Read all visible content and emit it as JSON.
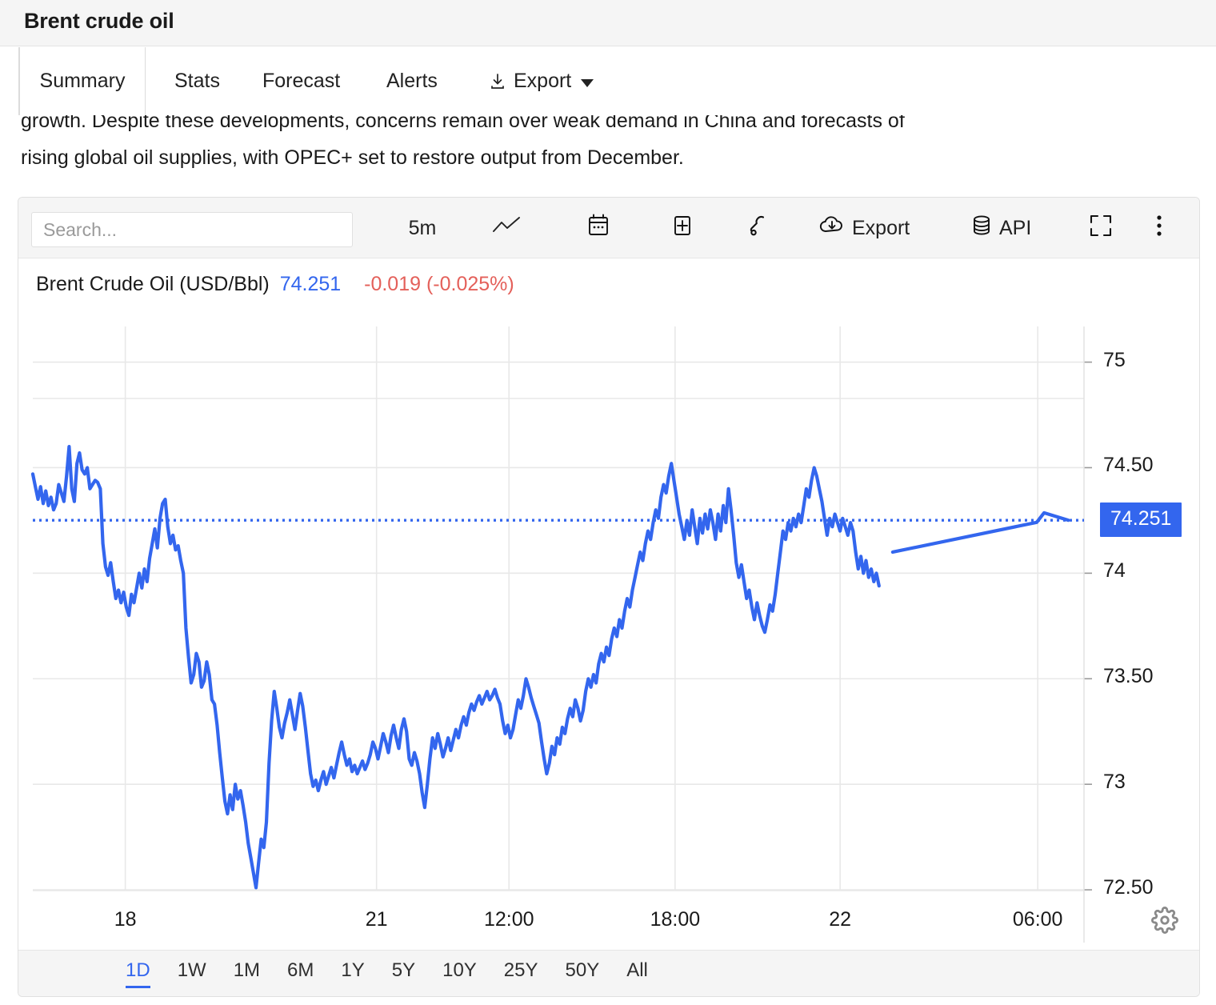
{
  "header": {
    "title": "Brent crude oil"
  },
  "tabs": [
    {
      "label": "Summary",
      "active": true
    },
    {
      "label": "Stats",
      "active": false
    },
    {
      "label": "Forecast",
      "active": false
    },
    {
      "label": "Alerts",
      "active": false
    },
    {
      "label": "Export",
      "active": false,
      "icon": "download-icon",
      "caret": true
    }
  ],
  "intro": {
    "line1": "growth. Despite these developments, concerns remain over weak demand in China and forecasts of",
    "line2": "rising global oil supplies, with OPEC+ set to restore output from December."
  },
  "toolbar": {
    "search_placeholder": "Search...",
    "interval": "5m",
    "chart_type_icon": "line-chart-icon",
    "calendar_icon": "calendar-icon",
    "add_icon": "plus-box-icon",
    "tools_icon": "wrench-icon",
    "export_label": "Export",
    "export_icon": "cloud-download-icon",
    "api_label": "API",
    "api_icon": "database-icon",
    "fullscreen_icon": "fullscreen-icon",
    "more_icon": "kebab-menu-icon"
  },
  "quote": {
    "name": "Brent Crude Oil (USD/Bbl)",
    "price": "74.251",
    "change": "-0.019 (-0.025%)"
  },
  "settings": {
    "gear_icon": "gear-icon"
  },
  "ranges": [
    {
      "label": "1D",
      "active": true
    },
    {
      "label": "1W",
      "active": false
    },
    {
      "label": "1M",
      "active": false
    },
    {
      "label": "6M",
      "active": false
    },
    {
      "label": "1Y",
      "active": false
    },
    {
      "label": "5Y",
      "active": false
    },
    {
      "label": "10Y",
      "active": false
    },
    {
      "label": "25Y",
      "active": false
    },
    {
      "label": "50Y",
      "active": false
    },
    {
      "label": "All",
      "active": false
    }
  ],
  "colors": {
    "line": "#3366ee",
    "reference_line": "#3366ee",
    "badge_bg": "#3366ee",
    "price_text": "#3366ee",
    "change_text": "#e4605a",
    "grid": "#e8e8e8"
  },
  "chart_data": {
    "type": "line",
    "title": "Brent Crude Oil (USD/Bbl)",
    "xlabel": "",
    "ylabel": "USD/Bbl",
    "ylim": [
      72.25,
      75.15
    ],
    "xlim": [
      0,
      1
    ],
    "grid": true,
    "legend": "none",
    "interval": "5m",
    "last_value": 74.251,
    "change": -0.019,
    "change_pct": -0.025,
    "reference_line": 74.251,
    "yticks": [
      75,
      74.5,
      74,
      73.5,
      73,
      72.5
    ],
    "ytick_labels": [
      "75",
      "74.50",
      "74",
      "73.50",
      "73",
      "72.50"
    ],
    "xticks": [
      0.088,
      0.327,
      0.453,
      0.611,
      0.768,
      0.956
    ],
    "xtick_labels": [
      "18",
      "21",
      "12:00",
      "18:00",
      "22",
      "06:00"
    ],
    "series": [
      {
        "name": "Brent Crude Oil (USD/Bbl)",
        "values": [
          74.47,
          74.41,
          74.35,
          74.41,
          74.33,
          74.39,
          74.32,
          74.36,
          74.3,
          74.33,
          74.42,
          74.38,
          74.34,
          74.46,
          74.6,
          74.4,
          74.34,
          74.52,
          74.57,
          74.49,
          74.47,
          74.5,
          74.4,
          74.42,
          74.44,
          74.43,
          74.4,
          74.14,
          74.03,
          73.99,
          74.05,
          73.96,
          73.88,
          73.92,
          73.86,
          73.91,
          73.84,
          73.8,
          73.9,
          73.86,
          73.93,
          74.0,
          73.93,
          74.02,
          73.96,
          74.07,
          74.14,
          74.21,
          74.12,
          74.26,
          74.33,
          74.35,
          74.22,
          74.14,
          74.18,
          74.11,
          74.13,
          74.06,
          74.0,
          73.74,
          73.6,
          73.48,
          73.52,
          73.62,
          73.58,
          73.46,
          73.49,
          73.58,
          73.52,
          73.4,
          73.38,
          73.28,
          73.15,
          73.03,
          72.92,
          72.86,
          72.95,
          72.88,
          73.0,
          72.93,
          72.97,
          72.9,
          72.82,
          72.72,
          72.65,
          72.58,
          72.51,
          72.63,
          72.74,
          72.7,
          72.82,
          73.1,
          73.3,
          73.44,
          73.36,
          73.27,
          73.22,
          73.29,
          73.34,
          73.4,
          73.33,
          73.26,
          73.35,
          73.43,
          73.37,
          73.27,
          73.16,
          73.05,
          72.99,
          73.02,
          72.97,
          73.02,
          73.06,
          73.0,
          73.04,
          73.08,
          73.03,
          73.09,
          73.15,
          73.2,
          73.14,
          73.09,
          73.12,
          73.06,
          73.09,
          73.05,
          73.08,
          73.11,
          73.07,
          73.1,
          73.14,
          73.2,
          73.17,
          73.12,
          73.18,
          73.24,
          73.2,
          73.15,
          73.23,
          73.28,
          73.22,
          73.17,
          73.26,
          73.31,
          73.25,
          73.12,
          73.09,
          73.15,
          73.11,
          73.05,
          72.96,
          72.89,
          73.0,
          73.12,
          73.22,
          73.17,
          73.24,
          73.19,
          73.13,
          73.17,
          73.22,
          73.16,
          73.21,
          73.26,
          73.22,
          73.28,
          73.32,
          73.28,
          73.34,
          73.38,
          73.35,
          73.39,
          73.42,
          73.38,
          73.41,
          73.44,
          73.4,
          73.42,
          73.45,
          73.41,
          73.38,
          73.3,
          73.24,
          73.28,
          73.22,
          73.26,
          73.33,
          73.4,
          73.36,
          73.42,
          73.5,
          73.46,
          73.41,
          73.37,
          73.33,
          73.29,
          73.2,
          73.12,
          73.05,
          73.1,
          73.18,
          73.14,
          73.22,
          73.19,
          73.27,
          73.24,
          73.31,
          73.36,
          73.32,
          73.4,
          73.36,
          73.3,
          73.35,
          73.44,
          73.5,
          73.46,
          73.52,
          73.48,
          73.57,
          73.62,
          73.58,
          73.65,
          73.61,
          73.69,
          73.74,
          73.7,
          73.78,
          73.74,
          73.82,
          73.88,
          73.84,
          73.92,
          73.98,
          74.04,
          74.1,
          74.06,
          74.14,
          74.2,
          74.16,
          74.24,
          74.3,
          74.26,
          74.36,
          74.42,
          74.38,
          74.46,
          74.52,
          74.44,
          74.36,
          74.28,
          74.22,
          74.16,
          74.25,
          74.18,
          74.3,
          74.22,
          74.14,
          74.26,
          74.19,
          74.28,
          74.21,
          74.3,
          74.24,
          74.16,
          74.28,
          74.2,
          74.32,
          74.24,
          74.4,
          74.3,
          74.18,
          74.05,
          73.98,
          74.04,
          73.96,
          73.88,
          73.92,
          73.84,
          73.78,
          73.86,
          73.8,
          73.75,
          73.72,
          73.78,
          73.85,
          73.82,
          73.9,
          74.0,
          74.1,
          74.2,
          74.16,
          74.24,
          74.2,
          74.26,
          74.22,
          74.28,
          74.24,
          74.32,
          74.4,
          74.36,
          74.44,
          74.5,
          74.46,
          74.4,
          74.34,
          74.26,
          74.18,
          74.26,
          74.22,
          74.28,
          74.24,
          74.2,
          74.26,
          74.22,
          74.18,
          74.24,
          74.2,
          74.1,
          74.02,
          74.08,
          74.0,
          74.06,
          73.98,
          74.02,
          73.96,
          74.0,
          73.94
        ]
      }
    ],
    "trailing_flat": {
      "start_value": 74.1,
      "end_value": 74.251,
      "note": "flat extension to last price"
    }
  }
}
